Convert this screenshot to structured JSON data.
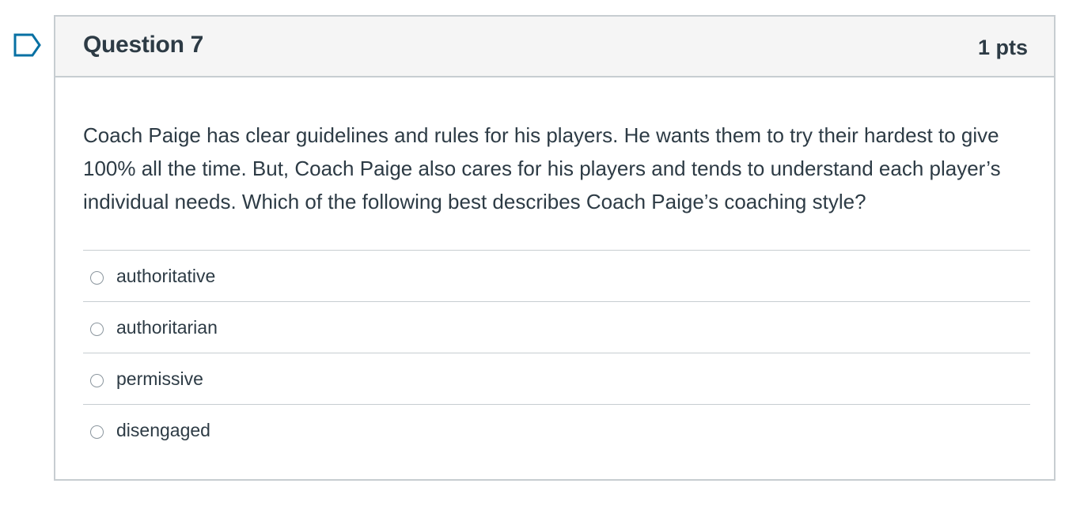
{
  "question": {
    "title": "Question 7",
    "points": "1 pts",
    "text": "Coach Paige has clear guidelines and rules for his players. He wants them to try their hardest to give 100% all the time. But, Coach Paige also cares for his players and tends to understand each player’s individual needs. Which of the following best describes Coach Paige’s coaching style?",
    "answers": [
      {
        "label": "authoritative",
        "selected": false
      },
      {
        "label": "authoritarian",
        "selected": false
      },
      {
        "label": "permissive",
        "selected": false
      },
      {
        "label": "disengaged",
        "selected": false
      }
    ]
  },
  "colors": {
    "text": "#2d3b45",
    "border": "#c7cdd1",
    "header_bg": "#f5f5f5",
    "flag_stroke": "#0770a3"
  },
  "icons": {
    "flag": "flag-bookmark-icon"
  }
}
